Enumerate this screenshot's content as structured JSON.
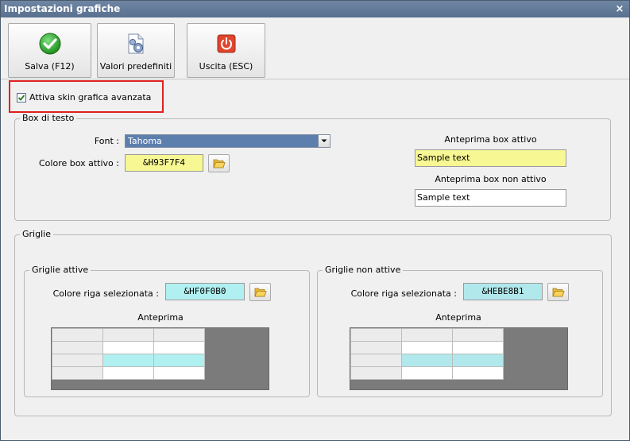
{
  "window": {
    "title": "Impostazioni grafiche",
    "close_glyph": "×"
  },
  "toolbar": {
    "save_label": "Salva (F12)",
    "defaults_label": "Valori predefiniti",
    "exit_label": "Uscita (ESC)"
  },
  "skin": {
    "label": "Attiva skin grafica avanzata",
    "checked": true
  },
  "textbox": {
    "legend": "Box di testo",
    "font_label": "Font :",
    "font_value": "Tahoma",
    "active_color_label": "Colore box attivo :",
    "active_color_value": "&H93F7F4",
    "active_color": "#f7f793",
    "preview_active_label": "Anteprima box attivo",
    "preview_active_text": "Sample text",
    "preview_inactive_label": "Anteprima box non attivo",
    "preview_inactive_text": "Sample text"
  },
  "grids": {
    "legend": "Griglie",
    "active": {
      "legend": "Griglie attive",
      "row_label": "Colore riga selezionata :",
      "row_value": "&HF0F0B0",
      "row_color": "#b0f0f0",
      "preview_label": "Anteprima"
    },
    "inactive": {
      "legend": "Griglie non attive",
      "row_label": "Colore riga selezionata :",
      "row_value": "&HEBE8B1",
      "row_color": "#b1e8eb",
      "preview_label": "Anteprima"
    }
  },
  "icons": {
    "save": "check-circle-icon",
    "defaults": "document-gear-icon",
    "exit": "power-icon",
    "folder": "folder-icon"
  }
}
